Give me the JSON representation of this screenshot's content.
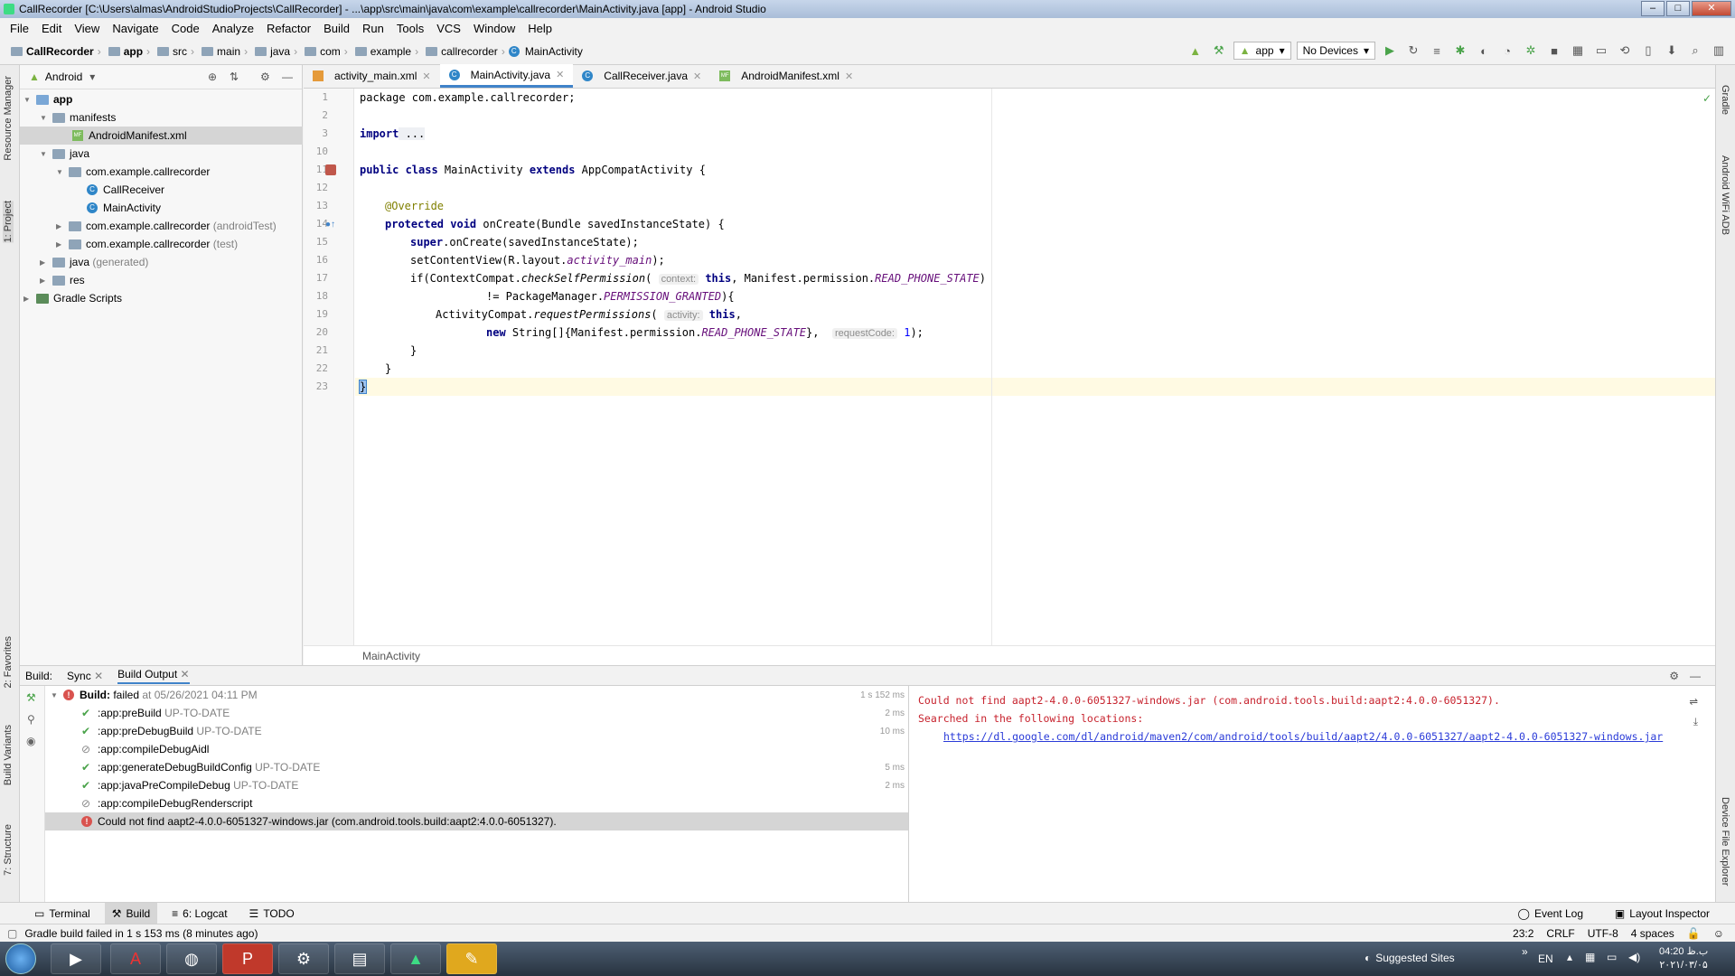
{
  "window": {
    "title": "CallRecorder [C:\\Users\\almas\\AndroidStudioProjects\\CallRecorder] - ...\\app\\src\\main\\java\\com\\example\\callrecorder\\MainActivity.java [app] - Android Studio"
  },
  "menu": [
    "File",
    "Edit",
    "View",
    "Navigate",
    "Code",
    "Analyze",
    "Refactor",
    "Build",
    "Run",
    "Tools",
    "VCS",
    "Window",
    "Help"
  ],
  "breadcrumbs": [
    "CallRecorder",
    "app",
    "src",
    "main",
    "java",
    "com",
    "example",
    "callrecorder",
    "MainActivity"
  ],
  "toolbar": {
    "config": "app",
    "device": "No Devices"
  },
  "left_strip": {
    "resource_manager": "Resource Manager",
    "project": "1: Project",
    "favorites": "2: Favorites",
    "build_variants": "Build Variants",
    "structure": "7: Structure"
  },
  "right_strip": {
    "gradle": "Gradle",
    "wifi_adb": "Android WiFi ADB",
    "device_file": "Device File Explorer"
  },
  "project": {
    "view": "Android",
    "tree": [
      {
        "label": "app",
        "level": 0
      },
      {
        "label": "manifests",
        "level": 1
      },
      {
        "label": "AndroidManifest.xml",
        "level": 2
      },
      {
        "label": "java",
        "level": 1
      },
      {
        "label": "com.example.callrecorder",
        "level": 2
      },
      {
        "label": "CallReceiver",
        "level": 3
      },
      {
        "label": "MainActivity",
        "level": 3
      },
      {
        "label": "com.example.callrecorder",
        "suffix": "(androidTest)",
        "level": 2
      },
      {
        "label": "com.example.callrecorder",
        "suffix": "(test)",
        "level": 2
      },
      {
        "label": "java",
        "suffix": "(generated)",
        "level": 1
      },
      {
        "label": "res",
        "level": 1
      },
      {
        "label": "Gradle Scripts",
        "level": 0
      }
    ]
  },
  "tabs": [
    "activity_main.xml",
    "MainActivity.java",
    "CallReceiver.java",
    "AndroidManifest.xml"
  ],
  "editor": {
    "line_numbers": [
      "1",
      "2",
      "3",
      "10",
      "11",
      "12",
      "13",
      "14",
      "15",
      "16",
      "17",
      "18",
      "19",
      "20",
      "21",
      "22",
      "23"
    ],
    "breadcrumb": "MainActivity",
    "code": {
      "l1": "package com.example.callrecorder;",
      "l3a": "import",
      "l3b": " ...",
      "l11a": "public class",
      "l11b": " MainActivity ",
      "l11c": "extends",
      "l11d": " AppCompatActivity {",
      "l13": "@Override",
      "l14a": "protected void",
      "l14b": " onCreate(Bundle savedInstanceState) {",
      "l15a": "super",
      "l15b": ".onCreate(savedInstanceState);",
      "l16a": "setContentView(R.layout.",
      "l16b": "activity_main",
      "l16c": ");",
      "l17a": "if(ContextCompat.",
      "l17b": "checkSelfPermission",
      "l17c": "( ",
      "l17hint": "context:",
      "l17d": " this",
      "l17e": ", Manifest.permission.",
      "l17f": "READ_PHONE_STATE",
      "l17g": ")",
      "l18a": "!= PackageManager.",
      "l18b": "PERMISSION_GRANTED",
      "l18c": "){",
      "l19a": "ActivityCompat.",
      "l19b": "requestPermissions",
      "l19c": "( ",
      "l19hint": "activity:",
      "l19d": " this",
      "l19e": ",",
      "l20a": "new",
      "l20b": " String[]{Manifest.permission.",
      "l20c": "READ_PHONE_STATE",
      "l20d": "},  ",
      "l20hint": "requestCode:",
      "l20e": " 1",
      "l20f": ");",
      "l21": "}",
      "l22": "}",
      "l23": "}"
    }
  },
  "build": {
    "tabs": [
      "Build:",
      "Sync",
      "Build Output"
    ],
    "root": {
      "label": "Build:",
      "status": "failed",
      "at": "at 05/26/2021 04:11 PM",
      "time": "1 s 152 ms"
    },
    "tasks": [
      {
        "name": ":app:preBuild",
        "state": "UP-TO-DATE",
        "time": "2 ms",
        "icon": "ok"
      },
      {
        "name": ":app:preDebugBuild",
        "state": "UP-TO-DATE",
        "time": "10 ms",
        "icon": "ok"
      },
      {
        "name": ":app:compileDebugAidl",
        "state": "",
        "time": "",
        "icon": "skip"
      },
      {
        "name": ":app:generateDebugBuildConfig",
        "state": "UP-TO-DATE",
        "time": "5 ms",
        "icon": "ok"
      },
      {
        "name": ":app:javaPreCompileDebug",
        "state": "UP-TO-DATE",
        "time": "2 ms",
        "icon": "ok"
      },
      {
        "name": ":app:compileDebugRenderscript",
        "state": "",
        "time": "",
        "icon": "skip"
      }
    ],
    "error_row": "Could not find aapt2-4.0.0-6051327-windows.jar (com.android.tools.build:aapt2:4.0.0-6051327).",
    "log": {
      "line1": "Could not find aapt2-4.0.0-6051327-windows.jar (com.android.tools.build:aapt2:4.0.0-6051327).",
      "line2": "Searched in the following locations:",
      "link": "https://dl.google.com/dl/android/maven2/com/android/tools/build/aapt2/4.0.0-6051327/aapt2-4.0.0-6051327-windows.jar"
    }
  },
  "bottom_tabs": {
    "terminal": "Terminal",
    "build": "Build",
    "logcat": "6: Logcat",
    "todo": "TODO",
    "event_log": "Event Log",
    "layout_inspector": "Layout Inspector"
  },
  "status": {
    "message": "Gradle build failed in 1 s 153 ms (8 minutes ago)",
    "position": "23:2",
    "line_sep": "CRLF",
    "encoding": "UTF-8",
    "indent": "4 spaces"
  },
  "taskbar": {
    "suggested": "Suggested Sites",
    "lang": "EN",
    "time": "04:20 ب.ظ",
    "date": "۲۰۲۱/۰۳/۰۵"
  },
  "colors": {
    "accent": "#4083c9",
    "error": "#d9534f",
    "current_line": "#fffae3"
  }
}
